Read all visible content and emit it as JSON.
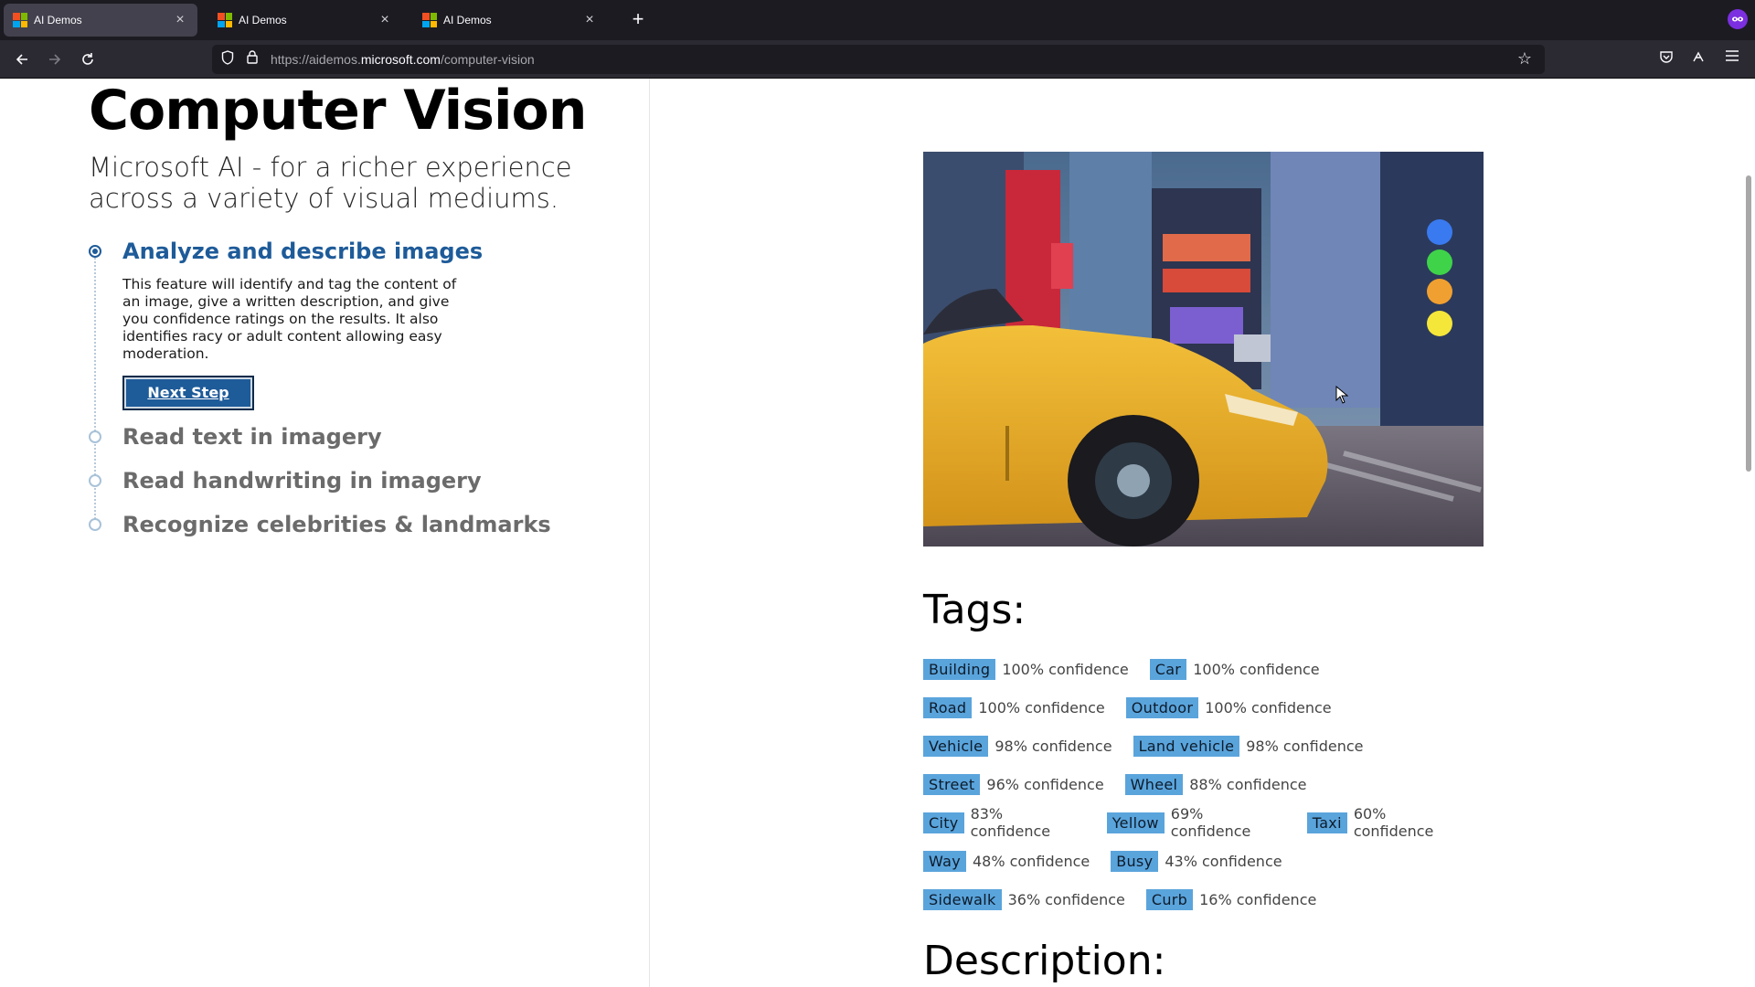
{
  "browser": {
    "tabs": [
      {
        "title": "AI Demos",
        "active": true
      },
      {
        "title": "AI Demos",
        "active": false
      },
      {
        "title": "AI Demos",
        "active": false
      }
    ],
    "url_prefix": "https://aidemos.",
    "url_domain": "microsoft.com",
    "url_path": "/computer-vision",
    "icons": {
      "back": "arrow-left-icon",
      "forward": "arrow-right-icon",
      "reload": "reload-icon",
      "shield": "shield-icon",
      "lock": "lock-icon",
      "bookmark": "star-icon",
      "pocket": "pocket-icon",
      "extensions": "extensions-icon",
      "menu": "hamburger-icon",
      "private": "mask-icon"
    }
  },
  "page": {
    "title": "Computer Vision",
    "subtitle": "Microsoft AI - for a richer experience across a variety of visual mediums.",
    "steps": [
      {
        "title": "Analyze and describe images",
        "description": "This feature will identify and tag the content of an image, give a written description, and give you confidence ratings on the results. It also identifies racy or adult content allowing easy moderation.",
        "button": "Next Step",
        "active": true
      },
      {
        "title": "Read text in imagery",
        "active": false
      },
      {
        "title": "Read handwriting in imagery",
        "active": false
      },
      {
        "title": "Recognize celebrities & landmarks",
        "active": false
      }
    ],
    "image_subject": "yellow taxi on a city street",
    "tags_heading": "Tags:",
    "tag_rows": [
      [
        {
          "name": "Building",
          "confidence": "100% confidence"
        },
        {
          "name": "Car",
          "confidence": "100% confidence"
        }
      ],
      [
        {
          "name": "Road",
          "confidence": "100% confidence"
        },
        {
          "name": "Outdoor",
          "confidence": "100% confidence"
        }
      ],
      [
        {
          "name": "Vehicle",
          "confidence": "98% confidence"
        },
        {
          "name": "Land vehicle",
          "confidence": "98% confidence"
        }
      ],
      [
        {
          "name": "Street",
          "confidence": "96% confidence"
        },
        {
          "name": "Wheel",
          "confidence": "88% confidence"
        }
      ],
      [
        {
          "name": "City",
          "confidence": "83% confidence"
        },
        {
          "name": "Yellow",
          "confidence": "69% confidence"
        },
        {
          "name": "Taxi",
          "confidence": "60% confidence"
        }
      ],
      [
        {
          "name": "Way",
          "confidence": "48% confidence"
        },
        {
          "name": "Busy",
          "confidence": "43% confidence"
        }
      ],
      [
        {
          "name": "Sidewalk",
          "confidence": "36% confidence"
        },
        {
          "name": "Curb",
          "confidence": "16% confidence"
        }
      ]
    ],
    "description_heading": "Description:"
  },
  "colors": {
    "accent": "#1e5b99",
    "tag_chip": "#5aa4dc",
    "chrome_dark": "#1c1b22"
  }
}
